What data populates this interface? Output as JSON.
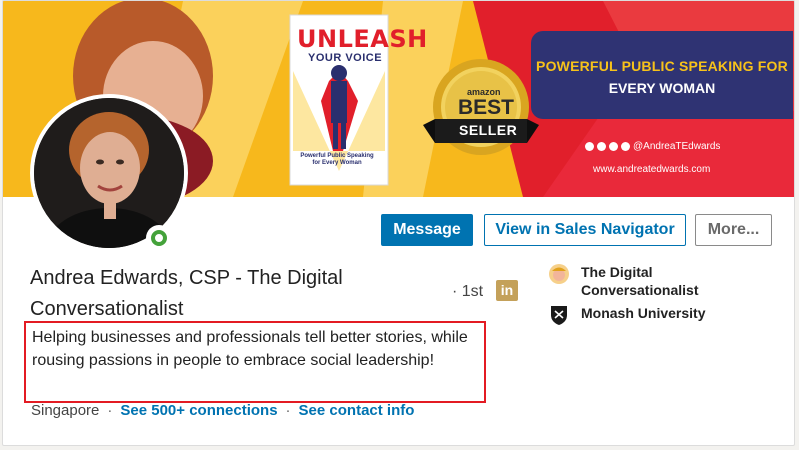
{
  "banner": {
    "book_title_line1": "UNLEASH",
    "book_title_line2": "YOUR VOICE",
    "book_subtitle": "Powerful Public Speaking for Every Woman",
    "badge_amazon": "amazon",
    "badge_best": "BEST",
    "badge_seller": "SELLER",
    "tagline_line1": "POWERFUL PUBLIC SPEAKING FOR",
    "tagline_line2": "EVERY WOMAN",
    "social_handle": "@AndreaTEdwards",
    "website": "www.andreatedwards.com"
  },
  "actions": {
    "message": "Message",
    "sales_navigator": "View in Sales Navigator",
    "more": "More..."
  },
  "profile": {
    "name": "Andrea Edwards, CSP - The Digital Conversationalist",
    "degree": "· 1st",
    "headline": "Helping businesses and professionals tell better stories, while rousing passions in people to embrace social leadership!",
    "location": "Singapore",
    "connections": "See 500+ connections",
    "contact": "See contact info"
  },
  "sidebar": {
    "company": "The Digital Conversationalist",
    "school": "Monash University"
  },
  "colors": {
    "accent_blue": "#0073b1",
    "highlight_red": "#e31b23",
    "online_green": "#44a23a",
    "banner_navy": "#2f3373",
    "banner_red": "#e11f2b"
  }
}
